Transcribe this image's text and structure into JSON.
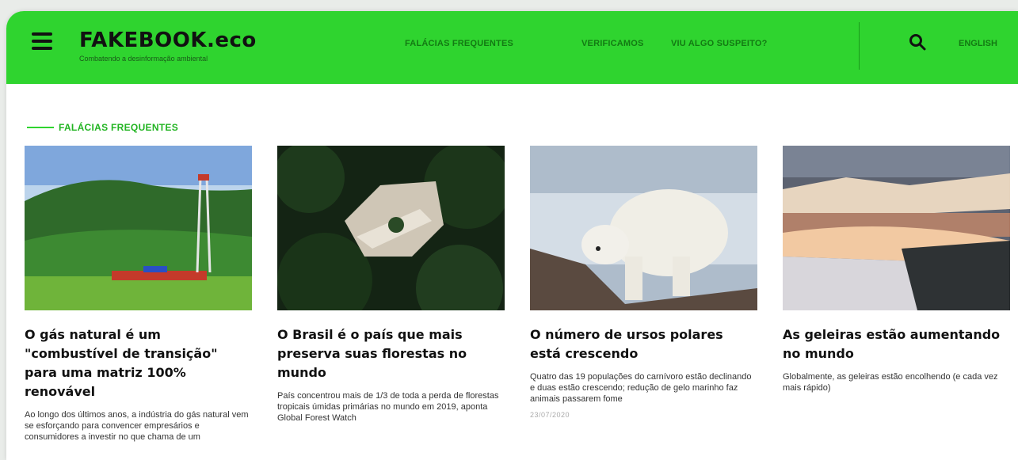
{
  "header": {
    "logo": "FAKEBOOK.eco",
    "tagline": "Combatendo a desinformação ambiental",
    "nav": [
      {
        "label": "FALÁCIAS FREQUENTES"
      },
      {
        "label": "VERIFICAMOS"
      },
      {
        "label": "VIU ALGO SUSPEITO?"
      }
    ],
    "language": "ENGLISH"
  },
  "section": {
    "title": "FALÁCIAS FREQUENTES"
  },
  "cards": [
    {
      "title": "O gás natural é um \"combustível de transição\" para uma matriz 100% renovável",
      "summary": "Ao longo dos últimos anos, a indústria do gás natural vem se esforçando para convencer empresários e consumidores a investir no que chama de um",
      "date": ""
    },
    {
      "title": "O Brasil é o país que mais preserva suas florestas no mundo",
      "summary": "País concentrou mais de 1/3 de toda a perda de florestas tropicais úmidas primárias no mundo em 2019, aponta Global Forest Watch",
      "date": ""
    },
    {
      "title": "O número de ursos polares está crescendo",
      "summary": "Quatro das 19 populações do carnívoro estão declinando e duas estão crescendo; redução de gelo marinho faz animais passarem fome",
      "date": "23/07/2020"
    },
    {
      "title": "As geleiras estão aumentando no mundo",
      "summary": "Globalmente, as geleiras estão encolhendo (e cada vez mais rápido)",
      "date": ""
    }
  ],
  "colors": {
    "brand_green": "#2fd42f",
    "nav_text": "#137a13"
  }
}
